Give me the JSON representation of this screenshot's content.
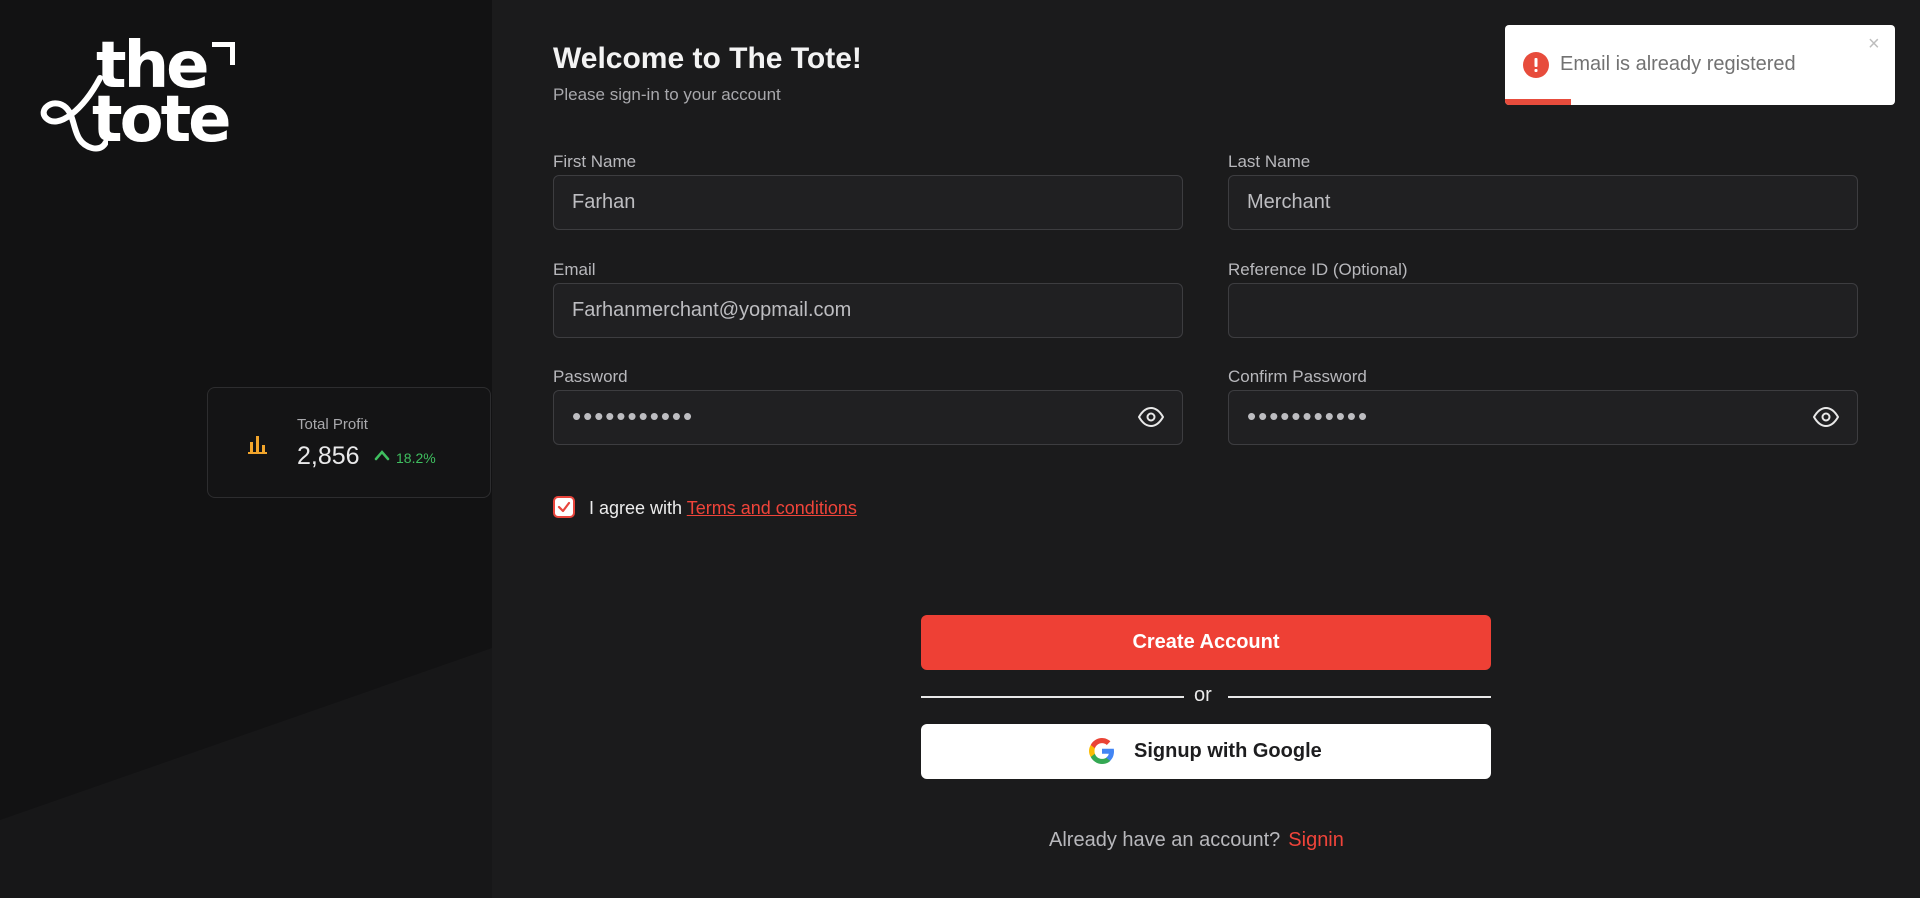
{
  "brand": {
    "logo_line1": "the",
    "logo_line2": "tote"
  },
  "stat_card": {
    "label": "Total Profit",
    "value": "2,856",
    "change": "18.2%",
    "icon": "bar-chart-icon",
    "trend": "up"
  },
  "form": {
    "title": "Welcome to The Tote!",
    "subtitle": "Please sign-in to your account",
    "first_name": {
      "label": "First Name",
      "value": "Farhan"
    },
    "last_name": {
      "label": "Last Name",
      "value": "Merchant"
    },
    "email": {
      "label": "Email",
      "value": "Farhanmerchant@yopmail.com"
    },
    "reference_id": {
      "label": "Reference ID (Optional)",
      "value": ""
    },
    "password": {
      "label": "Password",
      "value": "•••••••••••"
    },
    "confirm_password": {
      "label": "Confirm Password",
      "value": "•••••••••••"
    },
    "agree_text": "I agree with",
    "terms_link": "Terms and conditions",
    "agree_checked": true
  },
  "actions": {
    "create_account": "Create Account",
    "or": "or",
    "google_signup": "Signup with Google",
    "already_text": "Already have an account?",
    "signin_link": "Signin"
  },
  "toast": {
    "message": "Email is already registered",
    "close": "×",
    "progress": 0.17
  },
  "colors": {
    "accent": "#ee4035",
    "background": "#1b1b1c",
    "panel": "#121213",
    "success": "#3fbf5f"
  }
}
